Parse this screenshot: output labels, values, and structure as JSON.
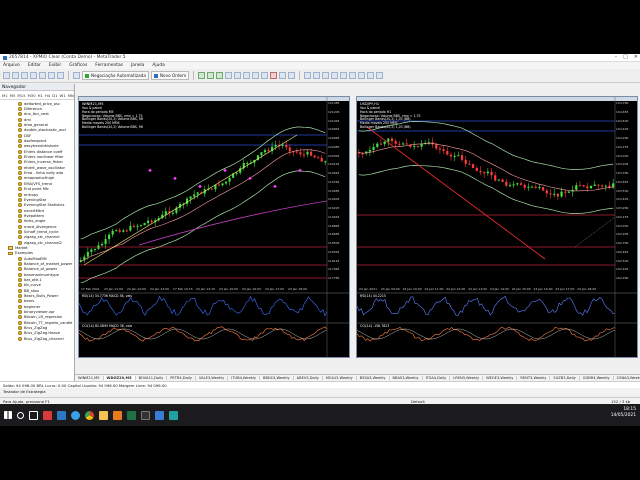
{
  "window": {
    "title": "2657814 - XPMIO Clear (Conta Demo) - MetaTrader 5"
  },
  "menu": [
    "Arquivo",
    "Editar",
    "Exibir",
    "Gráficos",
    "Ferramentas",
    "Janela",
    "Ajuda"
  ],
  "toolbar": {
    "auto_trading": "Negociação Automatizada",
    "new_order": "Novo Ordem"
  },
  "navigator": {
    "title": "Navegador",
    "tabs": [
      "M1",
      "M5",
      "M15",
      "M30",
      "H1",
      "H4",
      "D1",
      "W1",
      "MN"
    ],
    "items": [
      {
        "label": "deltorted_price_osc",
        "type": "indicator"
      },
      {
        "label": "Diferenca",
        "type": "indicator"
      },
      {
        "label": "dnx_tbn_next",
        "type": "indicator"
      },
      {
        "label": "dmi",
        "type": "indicator"
      },
      {
        "label": "dmo_general",
        "type": "indicator"
      },
      {
        "label": "double_stochastic_oscl",
        "type": "indicator"
      },
      {
        "label": "DSF",
        "type": "indicator"
      },
      {
        "label": "dsofrequant",
        "type": "indicator"
      },
      {
        "label": "easytrendnhistorie",
        "type": "indicator"
      },
      {
        "label": "Ehlers distance coeff",
        "type": "indicator"
      },
      {
        "label": "Ehlers nonlinear filter",
        "type": "indicator"
      },
      {
        "label": "Ehlers_inverse_fisher",
        "type": "indicator"
      },
      {
        "label": "ehlert_wave_oscillator",
        "type": "indicator"
      },
      {
        "label": "Ema - linha volty ada",
        "type": "indicator"
      },
      {
        "label": "emaproducthigh",
        "type": "indicator"
      },
      {
        "label": "EMA/VFS_trend",
        "type": "indicator"
      },
      {
        "label": "End point Mtr",
        "type": "indicator"
      },
      {
        "label": "entropy",
        "type": "indicator"
      },
      {
        "label": "EveningStar",
        "type": "indicator"
      },
      {
        "label": "EveningStar Statistics",
        "type": "indicator"
      },
      {
        "label": "excertMtrd",
        "type": "indicator"
      },
      {
        "label": "fivepattern",
        "type": "indicator"
      },
      {
        "label": "forex_angle",
        "type": "indicator"
      },
      {
        "label": "macd_divergence",
        "type": "indicator"
      },
      {
        "label": "Schaff_trend_cycle",
        "type": "indicator"
      },
      {
        "label": "zigzag_stc_channel",
        "type": "indicator"
      },
      {
        "label": "zigzag_stc_channel2",
        "type": "indicator"
      },
      {
        "label": "Market",
        "type": "folder"
      },
      {
        "label": "Examples",
        "type": "folder"
      },
      {
        "label": "AutoFiboEMI",
        "type": "indicator"
      },
      {
        "label": "Balance_of_market_power",
        "type": "indicator"
      },
      {
        "label": "Balance_of_power",
        "type": "indicator"
      },
      {
        "label": "barsmaximumtype",
        "type": "indicator"
      },
      {
        "label": "bat_attr.1",
        "type": "indicator"
      },
      {
        "label": "bb_curve",
        "type": "indicator"
      },
      {
        "label": "BB_stop",
        "type": "indicator"
      },
      {
        "label": "Bears_Bulls_Power",
        "type": "indicator"
      },
      {
        "label": "bears",
        "type": "indicator"
      },
      {
        "label": "beginner",
        "type": "indicator"
      },
      {
        "label": "binaryviewer.xpr",
        "type": "indicator"
      },
      {
        "label": "Bitcoin_LR_regresion",
        "type": "indicator"
      },
      {
        "label": "Bitcoin_TT_regreto_candle",
        "type": "indicator"
      },
      {
        "label": "Brus_ZigZag",
        "type": "indicator"
      },
      {
        "label": "Brus_ZigZag.Heave",
        "type": "indicator"
      },
      {
        "label": "Brus_ZigZag_channel",
        "type": "indicator"
      }
    ],
    "bottom_tabs": [
      "Comum",
      "Favoritos"
    ]
  },
  "charts": [
    {
      "title": "WINM21,M5",
      "info": [
        "Vou & painel",
        "Hora do periodo M5",
        "Negociacao: Volume BBS, vmx = 1,75",
        "Bollinger Bands(20,2) Volume BBS, 96",
        "Media moveis 200 MMS",
        "Bollinger Bands(20,2) Volume BBS, 96"
      ],
      "price_labels": [
        "121385",
        "121205",
        "121025",
        "120845",
        "120665",
        "120485",
        "120305",
        "120125",
        "119945",
        "119765",
        "119585",
        "119405",
        "119225",
        "119045",
        "118865",
        "118685",
        "118505",
        "118325",
        "118145",
        "117965",
        "117785"
      ],
      "time_labels": [
        "17 Feb 2021",
        "24 Jan 11:00",
        "24 Jan 12:00",
        "24 Jan 13:00",
        "17 Feb 10:15",
        "24 Jan 14:15",
        "24 Jan 15:00",
        "24 Jan 16:00",
        "24 Jan 17:00",
        "24 Jan 18:00"
      ],
      "sub1_title": "RSI(14) 34.7736 MACD 38, vals",
      "sub2_title": "CCI(14) 82.0895 MACD 38, vals"
    },
    {
      "title": "USDJPY,H1",
      "info": [
        "Vou & painel",
        "Hora do periodo H1",
        "Negociacao: Volume BBS, vmx = 1,75",
        "Bollinger Bands(20,2) 1,03 (BB)",
        "Media moveis 200 MMS",
        "Bollinger Bands(20,2) 1,03 (BB)"
      ],
      "price_labels": [
        "104,780",
        "104,655",
        "104,530",
        "104,405",
        "104,280",
        "104,155",
        "104,030",
        "103,905",
        "103,780",
        "103,655",
        "103,530",
        "103,405",
        "103,280",
        "103,155",
        "103,030",
        "102,905",
        "102,780",
        "102,655",
        "102,530",
        "102,405",
        "102,280"
      ],
      "time_labels": [
        "24 Jan 2021",
        "24 Jan 09:00",
        "24 Jan 10:00",
        "24 Jan 11:00",
        "24 Jan 12:00",
        "24 Jan 13:00",
        "24 Jan 14:00",
        "24 Jan 15:00",
        "24 Jan 16:00",
        "24 Jan 17:00",
        "24 Jan 18:00"
      ],
      "sub1_title": "RSI(14) 44.2215",
      "sub2_title": "CCI(14) -156.7823"
    }
  ],
  "symbol_tabs": [
    "WINM21,M5",
    "WDOZ20,M5",
    "BOVA11,Daily",
    "PETR4,Daily",
    "VALE3,Weekly",
    "ITUB4,Weekly",
    "BBDC4,Weekly",
    "ABEV3,Daily",
    "MGLU3,Weekly",
    "B3SA3,Weekly",
    "BBAS3,Weekly",
    "ITSA4,Daily",
    "LREN3,Weekly",
    "WEGE3,Weekly",
    "RENT3,Weekly",
    "SUZB3,Daily",
    "GGBR4,Weekly",
    "CSNA3,Weekly",
    "USIM5,Daily",
    "CMIG4,Weekly",
    "BRFS3,Weekly",
    "JBSS3,Weekly",
    "RADL3,Weekly",
    "CIEL3,Weekly",
    "BRKM5,Weekly",
    "EMBR3,Weekly",
    "CSAN3,Weekly",
    "ELET3,Weekly"
  ],
  "status": {
    "balance": "Saldo: 94 096.00 BRL  Lucro: 0.00  Capital Liquido: 94 096.00  Margem Livre: 94 096.00",
    "strategy": "Testador de Estrategia",
    "help": "Para Ajuda, pressione F1",
    "profile": "Default",
    "connection": "152 / 3 kb"
  },
  "toolbox_tabs": [
    "Comum",
    "Favoritos"
  ],
  "tray": {
    "time": "18:15",
    "date": "14/05/2021"
  }
}
